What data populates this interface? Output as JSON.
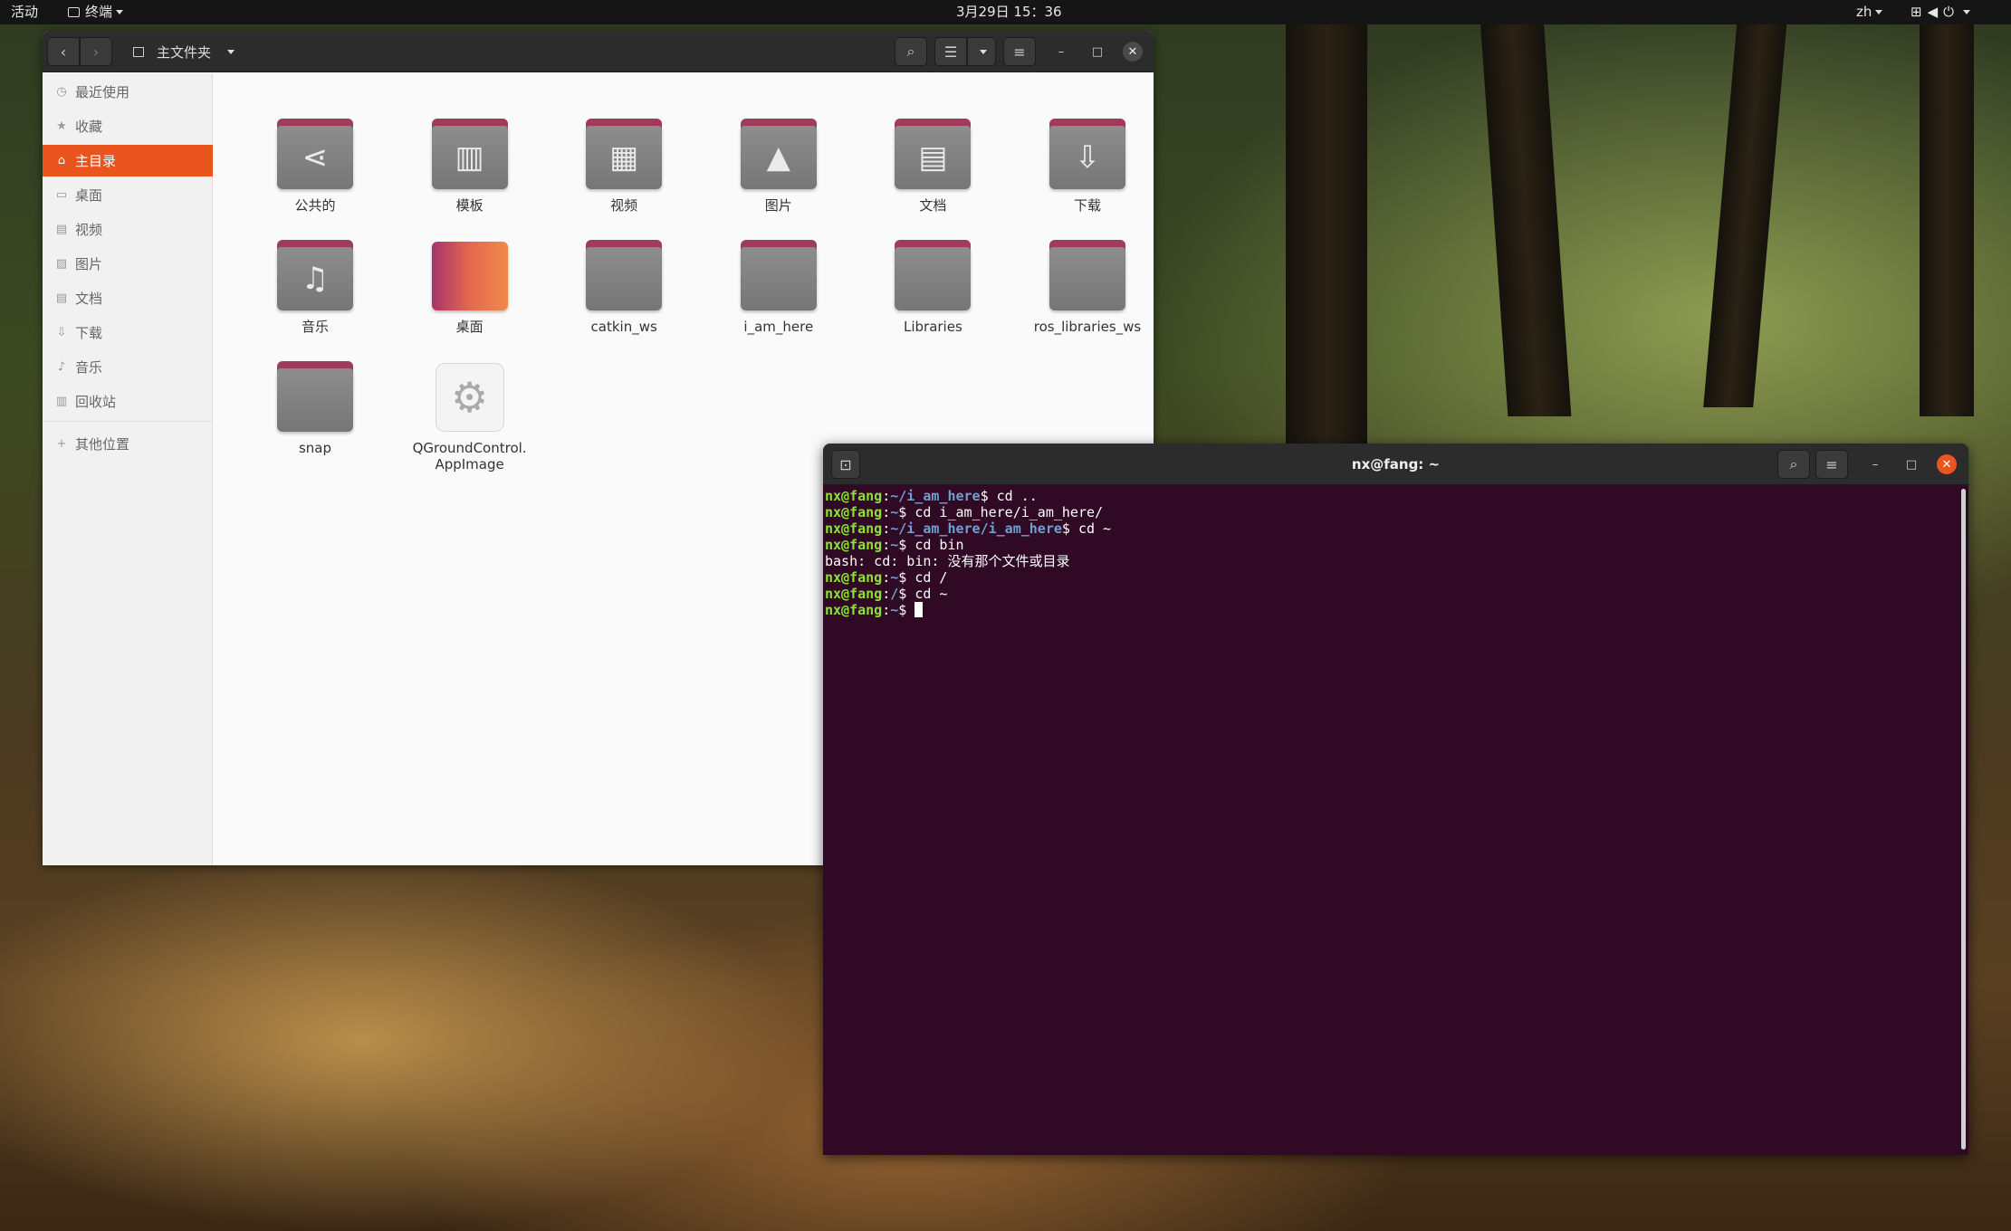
{
  "topbar": {
    "activities": "活动",
    "app_name": "终端",
    "clock": "3月29日 15：36",
    "lang": "zh",
    "system_icons": [
      "network-icon",
      "volume-icon",
      "power-icon"
    ]
  },
  "file_manager": {
    "path_label": "主文件夹",
    "sidebar": [
      {
        "label": "最近使用",
        "icon": "clock-icon"
      },
      {
        "label": "收藏",
        "icon": "star-icon"
      },
      {
        "label": "主目录",
        "icon": "home-icon",
        "active": true
      },
      {
        "label": "桌面",
        "icon": "desktop-icon"
      },
      {
        "label": "视频",
        "icon": "video-icon"
      },
      {
        "label": "图片",
        "icon": "picture-icon"
      },
      {
        "label": "文档",
        "icon": "document-icon"
      },
      {
        "label": "下载",
        "icon": "download-icon"
      },
      {
        "label": "音乐",
        "icon": "music-icon"
      },
      {
        "label": "回收站",
        "icon": "trash-icon"
      },
      {
        "label": "其他位置",
        "icon": "plus-icon"
      }
    ],
    "items": [
      {
        "label": "公共的",
        "kind": "folder",
        "glyph": "⋖"
      },
      {
        "label": "模板",
        "kind": "folder",
        "glyph": "▥"
      },
      {
        "label": "视频",
        "kind": "folder",
        "glyph": "▦"
      },
      {
        "label": "图片",
        "kind": "folder",
        "glyph": "▲"
      },
      {
        "label": "文档",
        "kind": "folder",
        "glyph": "▤"
      },
      {
        "label": "下载",
        "kind": "folder",
        "glyph": "⇩"
      },
      {
        "label": "音乐",
        "kind": "folder",
        "glyph": "♫"
      },
      {
        "label": "桌面",
        "kind": "desktop",
        "glyph": ""
      },
      {
        "label": "catkin_ws",
        "kind": "folder",
        "glyph": ""
      },
      {
        "label": "i_am_here",
        "kind": "folder",
        "glyph": ""
      },
      {
        "label": "Libraries",
        "kind": "folder",
        "glyph": ""
      },
      {
        "label": "ros_libraries_ws",
        "kind": "folder",
        "glyph": ""
      },
      {
        "label": "snap",
        "kind": "folder",
        "glyph": ""
      },
      {
        "label": "QGroundControl.\nAppImage",
        "kind": "app",
        "glyph": "⚙"
      }
    ]
  },
  "terminal": {
    "title": "nx@fang: ~",
    "lines": [
      {
        "user": "nx@fang",
        "path": "~/i_am_here",
        "cmd": "$ cd .."
      },
      {
        "user": "nx@fang",
        "path": "~",
        "cmd": "$ cd i_am_here/i_am_here/"
      },
      {
        "user": "nx@fang",
        "path": "~/i_am_here/i_am_here",
        "cmd": "$ cd ~"
      },
      {
        "user": "nx@fang",
        "path": "~",
        "cmd": "$ cd bin"
      },
      {
        "output": "bash: cd: bin: 没有那个文件或目录"
      },
      {
        "user": "nx@fang",
        "path": "~",
        "cmd": "$ cd /"
      },
      {
        "user": "nx@fang",
        "path": "/",
        "cmd": "$ cd ~"
      },
      {
        "user": "nx@fang",
        "path": "~",
        "cmd": "$ ",
        "cursor": true
      }
    ]
  }
}
